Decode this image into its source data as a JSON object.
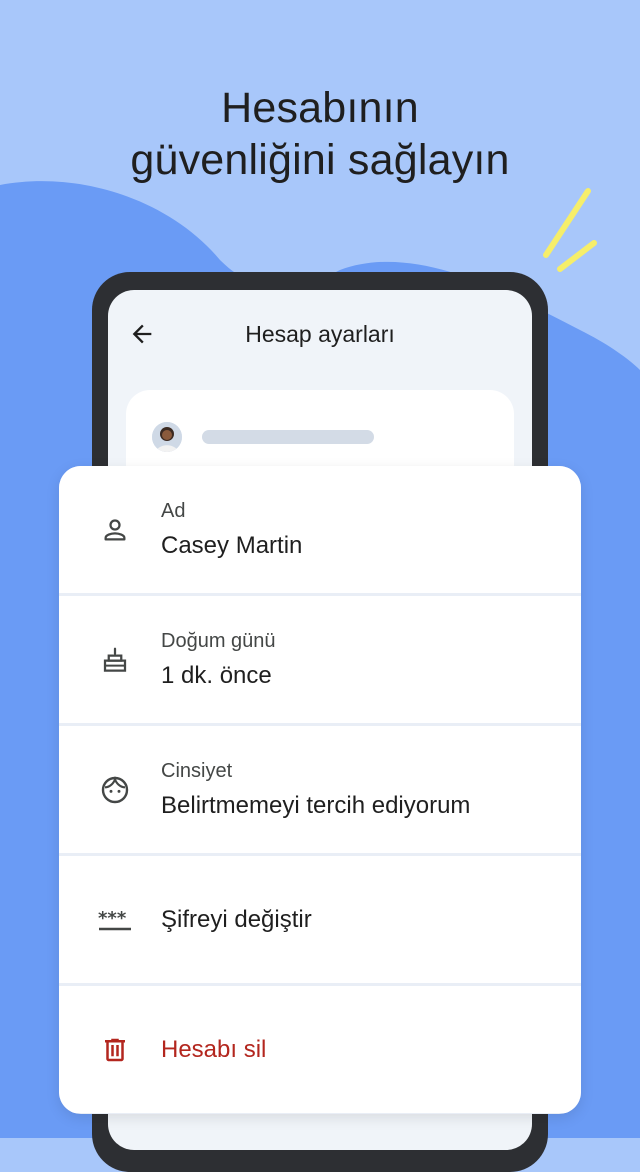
{
  "headline": {
    "line1": "Hesabının",
    "line2": "güvenliğini sağlayın"
  },
  "screen": {
    "title": "Hesap ayarları",
    "back_icon": "arrow-back-icon"
  },
  "profile": {
    "avatar": "user-avatar"
  },
  "settings": [
    {
      "icon": "person-icon",
      "label": "Ad",
      "value": "Casey Martin"
    },
    {
      "icon": "cake-icon",
      "label": "Doğum günü",
      "value": "1 dk. önce"
    },
    {
      "icon": "face-icon",
      "label": "Cinsiyet",
      "value": "Belirtmemeyi tercih ediyorum"
    },
    {
      "icon": "password-icon",
      "label": "Şifreyi değiştir"
    },
    {
      "icon": "trash-icon",
      "label": "Hesabı sil"
    }
  ],
  "colors": {
    "background": "#a8c7fa",
    "accent_blob": "#6a9bf5",
    "danger": "#b3261e",
    "sparkle": "#f6ee6a"
  }
}
